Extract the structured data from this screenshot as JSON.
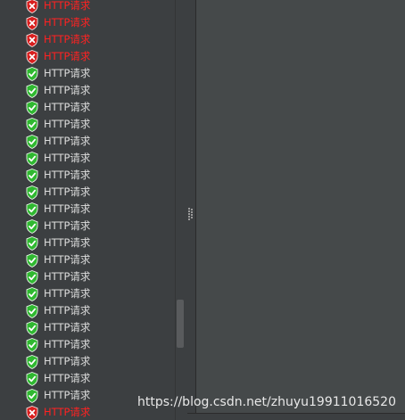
{
  "tree": {
    "items": [
      {
        "label": "HTTP请求",
        "status": "error",
        "icon": "error-shield-icon"
      },
      {
        "label": "HTTP请求",
        "status": "error",
        "icon": "error-shield-icon"
      },
      {
        "label": "HTTP请求",
        "status": "error",
        "icon": "error-shield-icon"
      },
      {
        "label": "HTTP请求",
        "status": "error",
        "icon": "error-shield-icon"
      },
      {
        "label": "HTTP请求",
        "status": "ok",
        "icon": "success-shield-icon"
      },
      {
        "label": "HTTP请求",
        "status": "ok",
        "icon": "success-shield-icon"
      },
      {
        "label": "HTTP请求",
        "status": "ok",
        "icon": "success-shield-icon"
      },
      {
        "label": "HTTP请求",
        "status": "ok",
        "icon": "success-shield-icon"
      },
      {
        "label": "HTTP请求",
        "status": "ok",
        "icon": "success-shield-icon"
      },
      {
        "label": "HTTP请求",
        "status": "ok",
        "icon": "success-shield-icon"
      },
      {
        "label": "HTTP请求",
        "status": "ok",
        "icon": "success-shield-icon"
      },
      {
        "label": "HTTP请求",
        "status": "ok",
        "icon": "success-shield-icon"
      },
      {
        "label": "HTTP请求",
        "status": "ok",
        "icon": "success-shield-icon"
      },
      {
        "label": "HTTP请求",
        "status": "ok",
        "icon": "success-shield-icon"
      },
      {
        "label": "HTTP请求",
        "status": "ok",
        "icon": "success-shield-icon"
      },
      {
        "label": "HTTP请求",
        "status": "ok",
        "icon": "success-shield-icon"
      },
      {
        "label": "HTTP请求",
        "status": "ok",
        "icon": "success-shield-icon"
      },
      {
        "label": "HTTP请求",
        "status": "ok",
        "icon": "success-shield-icon"
      },
      {
        "label": "HTTP请求",
        "status": "ok",
        "icon": "success-shield-icon"
      },
      {
        "label": "HTTP请求",
        "status": "ok",
        "icon": "success-shield-icon"
      },
      {
        "label": "HTTP请求",
        "status": "ok",
        "icon": "success-shield-icon"
      },
      {
        "label": "HTTP请求",
        "status": "ok",
        "icon": "success-shield-icon"
      },
      {
        "label": "HTTP请求",
        "status": "ok",
        "icon": "success-shield-icon"
      },
      {
        "label": "HTTP请求",
        "status": "ok",
        "icon": "success-shield-icon"
      },
      {
        "label": "HTTP请求",
        "status": "error",
        "icon": "error-shield-icon"
      }
    ]
  },
  "watermark": "https://blog.csdn.net/zhuyu19911016520",
  "colors": {
    "success": "#2fb830",
    "error": "#d81e1e",
    "error_text": "#ff2222",
    "panel_bg": "#3c3f41",
    "right_bg": "#45494a"
  }
}
